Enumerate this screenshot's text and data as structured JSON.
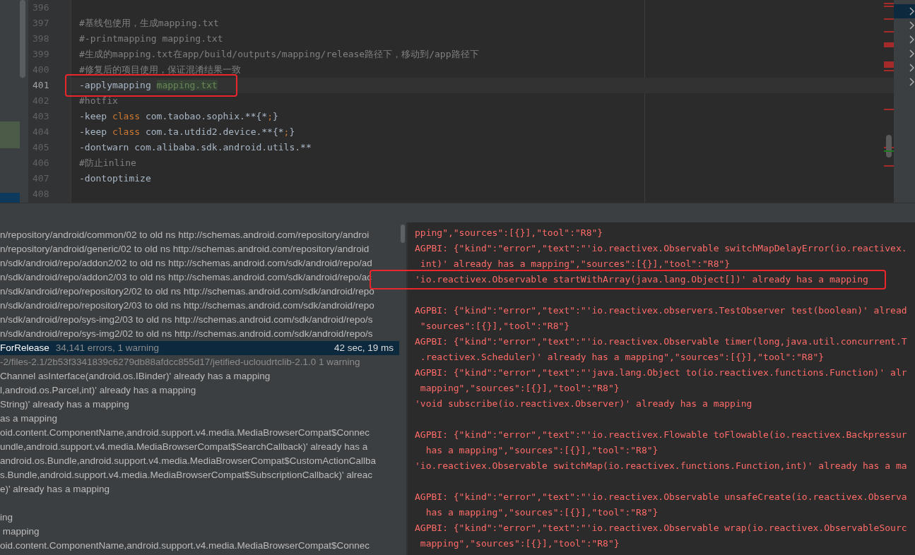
{
  "editor": {
    "lines": [
      {
        "number": "396",
        "current": false,
        "annotated": false
      },
      {
        "number": "397",
        "current": false,
        "annotated": false,
        "segments": [
          {
            "text": "#基线包使用，生成mapping.txt",
            "kind": "comment"
          }
        ]
      },
      {
        "number": "398",
        "current": false,
        "annotated": false,
        "segments": [
          {
            "text": "#-printmapping mapping.txt",
            "kind": "comment"
          }
        ]
      },
      {
        "number": "399",
        "current": false,
        "annotated": false,
        "segments": [
          {
            "text": "#生成的mapping.txt在app/build/outputs/mapping/release路径下，移动到/app路径下",
            "kind": "comment"
          }
        ]
      },
      {
        "number": "400",
        "current": false,
        "annotated": false,
        "segments": [
          {
            "text": "#修复后的项目使用，保证混淆结果一致",
            "kind": "comment"
          }
        ]
      },
      {
        "number": "401",
        "current": true,
        "annotated": true,
        "segments": [
          {
            "text": "-applymapping ",
            "kind": "plain"
          },
          {
            "text": "mapping.txt",
            "kind": "usage"
          }
        ]
      },
      {
        "number": "402",
        "current": false,
        "annotated": false,
        "segments": [
          {
            "text": "#hotfix",
            "kind": "comment"
          }
        ]
      },
      {
        "number": "403",
        "current": false,
        "annotated": false,
        "segments": [
          {
            "text": "-keep ",
            "kind": "plain"
          },
          {
            "text": "class",
            "kind": "keyword"
          },
          {
            "text": " com.taobao.sophix.**{*",
            "kind": "plain"
          },
          {
            "text": ";",
            "kind": "keyword"
          },
          {
            "text": "}",
            "kind": "plain"
          }
        ]
      },
      {
        "number": "404",
        "current": false,
        "annotated": false,
        "segments": [
          {
            "text": "-keep ",
            "kind": "plain"
          },
          {
            "text": "class",
            "kind": "keyword"
          },
          {
            "text": " com.ta.utdid2.device.**{*",
            "kind": "plain"
          },
          {
            "text": ";",
            "kind": "keyword"
          },
          {
            "text": "}",
            "kind": "plain"
          }
        ]
      },
      {
        "number": "405",
        "current": false,
        "annotated": false,
        "segments": [
          {
            "text": "-dontwarn com.alibaba.sdk.android.utils.**",
            "kind": "plain"
          }
        ]
      },
      {
        "number": "406",
        "current": false,
        "annotated": false,
        "segments": [
          {
            "text": "#防止inline",
            "kind": "comment"
          }
        ]
      },
      {
        "number": "407",
        "current": false,
        "annotated": false,
        "segments": [
          {
            "text": "-dontoptimize",
            "kind": "plain"
          }
        ]
      },
      {
        "number": "408",
        "current": false,
        "annotated": false
      }
    ]
  },
  "structure_items": [
    {
      "selected": true
    },
    {
      "selected": false
    },
    {
      "selected": false
    },
    {
      "selected": false
    },
    {
      "selected": false
    },
    {
      "selected": false
    }
  ],
  "build_tree": {
    "rows": [
      {
        "kind": "message",
        "text": "n/repository/android/common/02 to old ns http://schemas.android.com/repository/androi"
      },
      {
        "kind": "message",
        "text": "n/repository/android/generic/02 to old ns http://schemas.android.com/repository/android"
      },
      {
        "kind": "message",
        "text": "n/sdk/android/repo/addon2/02 to old ns http://schemas.android.com/sdk/android/repo/ad"
      },
      {
        "kind": "message",
        "text": "n/sdk/android/repo/addon2/03 to old ns http://schemas.android.com/sdk/android/repo/ac"
      },
      {
        "kind": "message",
        "text": "n/sdk/android/repo/repository2/02 to old ns http://schemas.android.com/sdk/android/repo"
      },
      {
        "kind": "message",
        "text": "n/sdk/android/repo/repository2/03 to old ns http://schemas.android.com/sdk/android/repo"
      },
      {
        "kind": "message",
        "text": "n/sdk/android/repo/sys-img2/03 to old ns http://schemas.android.com/sdk/android/repo/s"
      },
      {
        "kind": "message",
        "text": "n/sdk/android/repo/sys-img2/02 to old ns http://schemas.android.com/sdk/android/repo/s"
      },
      {
        "kind": "task",
        "selected": true,
        "text": "ForRelease",
        "summary": "34,141 errors, 1 warning",
        "duration": "42 sec, 19 ms"
      },
      {
        "kind": "file",
        "text": "-2/files-2.1/2b53f3341839c6279db88afdcc855d17/jetified-ucloudrtclib-2.1.0 1 warning"
      },
      {
        "kind": "message",
        "text": "Channel asInterface(android.os.IBinder)' already has a mapping"
      },
      {
        "kind": "message",
        "text": "l,android.os.Parcel,int)' already has a mapping"
      },
      {
        "kind": "message",
        "text": "String)' already has a mapping"
      },
      {
        "kind": "message",
        "text": "as a mapping"
      },
      {
        "kind": "message",
        "text": "oid.content.ComponentName,android.support.v4.media.MediaBrowserCompat$Connec"
      },
      {
        "kind": "message",
        "text": "undle,android.support.v4.media.MediaBrowserCompat$SearchCallback)' already has a"
      },
      {
        "kind": "message",
        "text": "android.os.Bundle,android.support.v4.media.MediaBrowserCompat$CustomActionCallba"
      },
      {
        "kind": "message",
        "text": "s.Bundle,android.support.v4.media.MediaBrowserCompat$SubscriptionCallback)' alreac"
      },
      {
        "kind": "message",
        "text": "e)' already has a mapping"
      },
      {
        "kind": "blank"
      },
      {
        "kind": "message",
        "text": "ing"
      },
      {
        "kind": "message",
        "text": " mapping"
      },
      {
        "kind": "message",
        "text": "oid.content.ComponentName,android.support.v4.media.MediaBrowserCompat$Connec"
      }
    ]
  },
  "console": {
    "lines": [
      {
        "text": "pping\",\"sources\":[{}],\"tool\":\"R8\"}",
        "annotated": false
      },
      {
        "text": "AGPBI: {\"kind\":\"error\",\"text\":\"'io.reactivex.Observable switchMapDelayError(io.reactivex.",
        "annotated": false
      },
      {
        "text": " int)' already has a mapping\",\"sources\":[{}],\"tool\":\"R8\"}",
        "annotated": false
      },
      {
        "text": "'io.reactivex.Observable startWithArray(java.lang.Object[])' already has a mapping",
        "annotated": true
      },
      {
        "annotated": false
      },
      {
        "text": "AGPBI: {\"kind\":\"error\",\"text\":\"'io.reactivex.observers.TestObserver test(boolean)' alread",
        "annotated": false
      },
      {
        "text": " \"sources\":[{}],\"tool\":\"R8\"}",
        "annotated": false
      },
      {
        "text": "AGPBI: {\"kind\":\"error\",\"text\":\"'io.reactivex.Observable timer(long,java.util.concurrent.T",
        "annotated": false
      },
      {
        "text": " .reactivex.Scheduler)' already has a mapping\",\"sources\":[{}],\"tool\":\"R8\"}",
        "annotated": false
      },
      {
        "text": "AGPBI: {\"kind\":\"error\",\"text\":\"'java.lang.Object to(io.reactivex.functions.Function)' alr",
        "annotated": false
      },
      {
        "text": " mapping\",\"sources\":[{}],\"tool\":\"R8\"}",
        "annotated": false
      },
      {
        "text": "'void subscribe(io.reactivex.Observer)' already has a mapping",
        "annotated": false
      },
      {
        "annotated": false
      },
      {
        "text": "AGPBI: {\"kind\":\"error\",\"text\":\"'io.reactivex.Flowable toFlowable(io.reactivex.Backpressur",
        "annotated": false
      },
      {
        "text": "  has a mapping\",\"sources\":[{}],\"tool\":\"R8\"}",
        "annotated": false
      },
      {
        "text": "'io.reactivex.Observable switchMap(io.reactivex.functions.Function,int)' already has a ma",
        "annotated": false
      },
      {
        "annotated": false
      },
      {
        "text": "AGPBI: {\"kind\":\"error\",\"text\":\"'io.reactivex.Observable unsafeCreate(io.reactivex.Observa",
        "annotated": false
      },
      {
        "text": "  has a mapping\",\"sources\":[{}],\"tool\":\"R8\"}",
        "annotated": false
      },
      {
        "text": "AGPBI: {\"kind\":\"error\",\"text\":\"'io.reactivex.Observable wrap(io.reactivex.ObservableSourc",
        "annotated": false
      },
      {
        "text": " mapping\",\"sources\":[{}],\"tool\":\"R8\"}",
        "annotated": false
      }
    ]
  }
}
